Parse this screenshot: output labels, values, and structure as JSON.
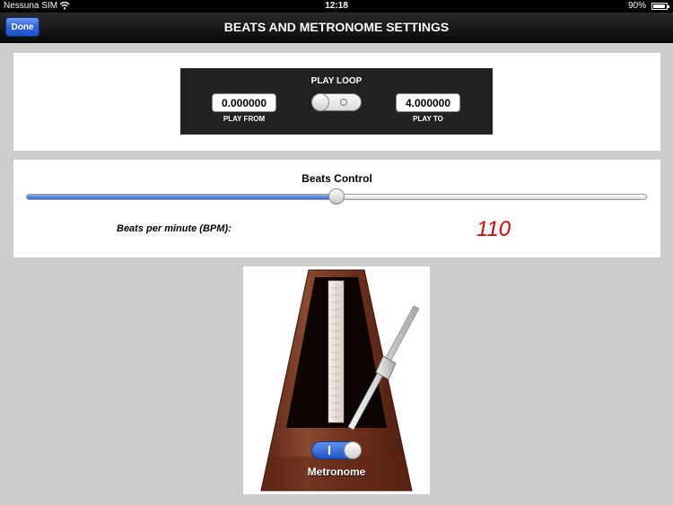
{
  "status_bar": {
    "carrier": "Nessuna SIM",
    "time": "12:18",
    "battery_percent": "90%",
    "battery_level": 0.9
  },
  "nav": {
    "done_label": "Done",
    "title": "BEATS AND METRONOME SETTINGS"
  },
  "loop": {
    "title": "PLAY LOOP",
    "play_from_value": "0.000000",
    "play_from_label": "PLAY FROM",
    "play_to_value": "4.000000",
    "play_to_label": "PLAY TO",
    "loop_enabled": false
  },
  "beats": {
    "title": "Beats Control",
    "slider_fraction": 0.5,
    "bpm_label": "Beats per minute (BPM):",
    "bpm_value": "110"
  },
  "metronome": {
    "switch_on": true,
    "label": "Metronome"
  },
  "colors": {
    "nav_background": "#111111",
    "done_button": "#2c62d8",
    "bpm_text": "#dd0000",
    "slider_fill": "#2e66cf",
    "metronome_wood": "#6e2f1c"
  },
  "icons": {
    "wifi": "wifi-icon",
    "battery": "battery-icon"
  }
}
